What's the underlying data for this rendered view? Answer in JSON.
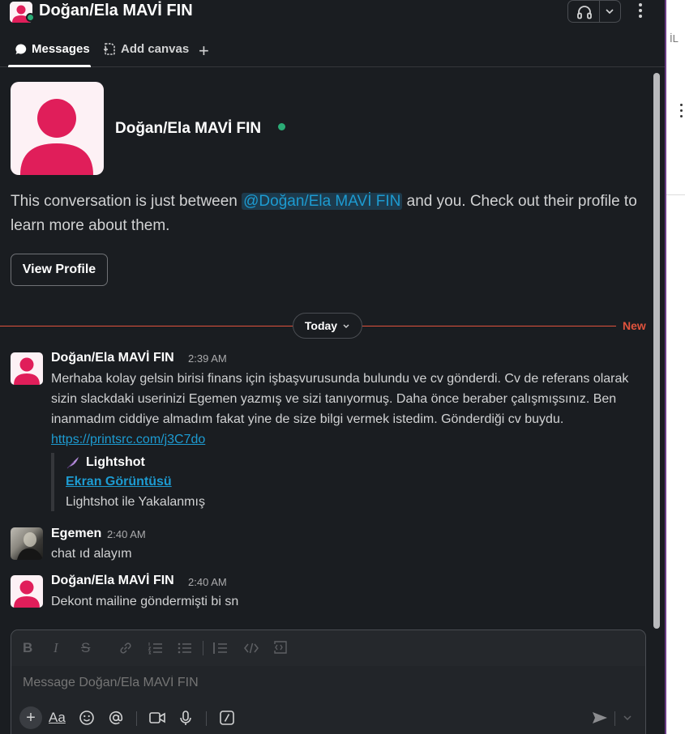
{
  "header": {
    "title": "Doğan/Ela MAVİ FIN"
  },
  "tabs": [
    {
      "label": "Messages"
    },
    {
      "label": "Add canvas"
    }
  ],
  "intro": {
    "name": "Doğan/Ela MAVİ FIN",
    "text_before": "This conversation is just between ",
    "mention": "@Doğan/Ela MAVİ FIN",
    "text_after": " and you. Check out their profile to learn more about them.",
    "view_profile_label": "View Profile"
  },
  "divider": {
    "today_label": "Today",
    "new_label": "New"
  },
  "messages": [
    {
      "author": "Doğan/Ela MAVİ FIN",
      "time": "2:39 AM",
      "text": "Merhaba kolay gelsin birisi finans için işbaşvurusunda bulundu ve cv gönderdi. Cv de  referans olarak sizin slackdaki userinizi Egemen yazmış ve sizi tanıyormuş. Daha önce beraber çalışmışsınız. Ben inanmadım ciddiye almadım fakat yine de size bilgi vermek istedim. Gönderdiği cv buydu.",
      "link": "https://printsrc.com/j3C7do",
      "unfurl": {
        "site": "Lightshot",
        "title": "Ekran Görüntüsü",
        "description": "Lightshot ile Yakalanmış"
      }
    },
    {
      "author": "Egemen",
      "time": "2:40 AM",
      "text": "chat ıd alayım"
    },
    {
      "author": "Doğan/Ela MAVİ FIN",
      "time": "2:40 AM",
      "text": "Dekont mailine göndermişti bi sn"
    }
  ],
  "composer": {
    "placeholder": "Message Doğan/Ela MAVİ FIN",
    "aa_label": "Aa"
  },
  "right_fragment": "İL",
  "colors": {
    "background": "#1a1d21",
    "link": "#1d9bd1",
    "presence": "#2bac76",
    "new_marker": "#e0533d",
    "avatar_person": "#e01e5a"
  }
}
